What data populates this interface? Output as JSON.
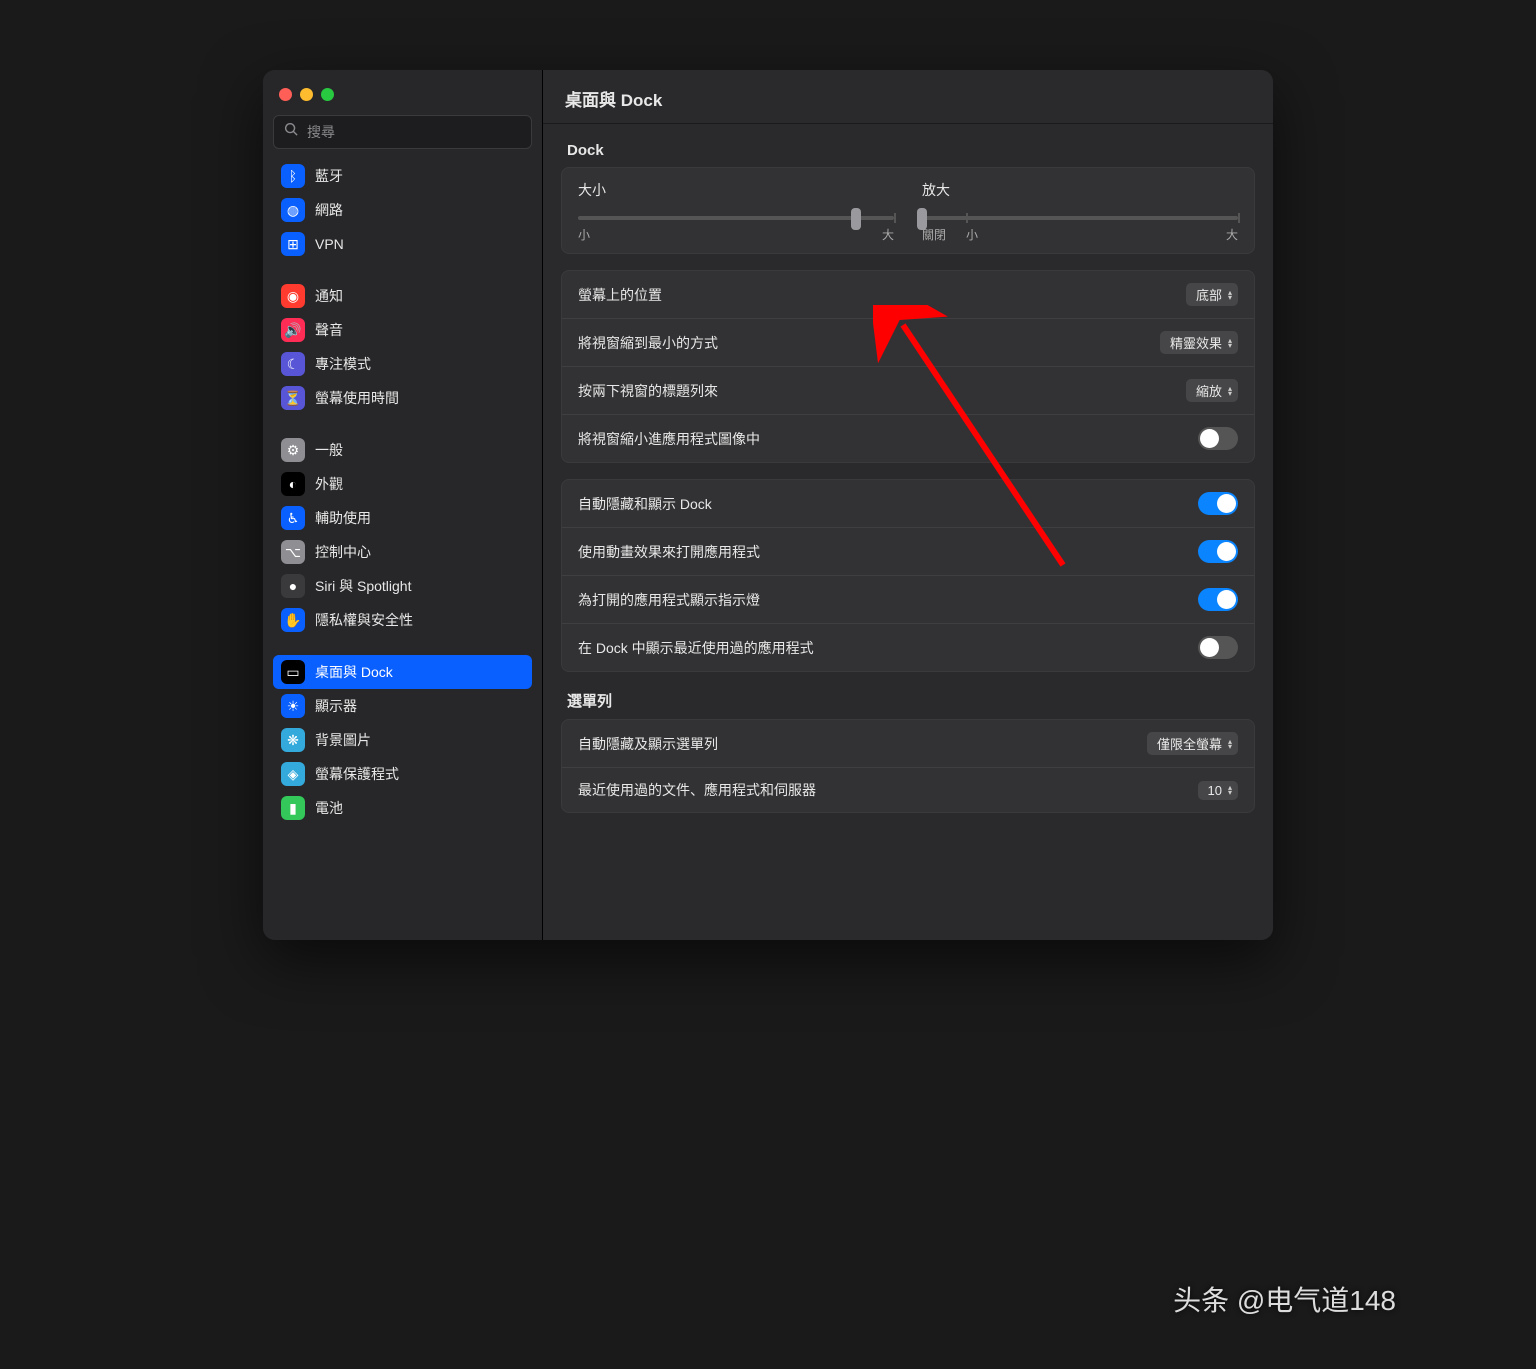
{
  "search": {
    "placeholder": "搜尋"
  },
  "sidebar": {
    "groups": [
      [
        {
          "label": "藍牙",
          "icon": "ᛒ",
          "bg": "#0a60ff"
        },
        {
          "label": "網路",
          "icon": "◍",
          "bg": "#0a60ff"
        },
        {
          "label": "VPN",
          "icon": "⊞",
          "bg": "#0a60ff"
        }
      ],
      [
        {
          "label": "通知",
          "icon": "◉",
          "bg": "#ff3b30"
        },
        {
          "label": "聲音",
          "icon": "🔊",
          "bg": "#ff2d55"
        },
        {
          "label": "專注模式",
          "icon": "☾",
          "bg": "#5856d6"
        },
        {
          "label": "螢幕使用時間",
          "icon": "⏳",
          "bg": "#5856d6"
        }
      ],
      [
        {
          "label": "一般",
          "icon": "⚙",
          "bg": "#8e8e93"
        },
        {
          "label": "外觀",
          "icon": "◐",
          "bg": "#000000"
        },
        {
          "label": "輔助使用",
          "icon": "♿︎",
          "bg": "#0a60ff"
        },
        {
          "label": "控制中心",
          "icon": "⌥",
          "bg": "#8e8e93"
        },
        {
          "label": "Siri 與 Spotlight",
          "icon": "●",
          "bg": "#3a3a3c"
        },
        {
          "label": "隱私權與安全性",
          "icon": "✋",
          "bg": "#0a60ff"
        }
      ],
      [
        {
          "label": "桌面與 Dock",
          "icon": "▭",
          "bg": "#000000",
          "selected": true
        },
        {
          "label": "顯示器",
          "icon": "☀",
          "bg": "#0a60ff"
        },
        {
          "label": "背景圖片",
          "icon": "❋",
          "bg": "#34aadc"
        },
        {
          "label": "螢幕保護程式",
          "icon": "◈",
          "bg": "#34aadc"
        },
        {
          "label": "電池",
          "icon": "▮",
          "bg": "#34c759"
        }
      ]
    ]
  },
  "page": {
    "title": "桌面與 Dock",
    "dock_section": "Dock",
    "menubar_section": "選單列",
    "size": {
      "label": "大小",
      "min": "小",
      "max": "大",
      "value_pct": 88
    },
    "mag": {
      "label": "放大",
      "off": "關閉",
      "min": "小",
      "max": "大",
      "value_pct": 0
    },
    "position": {
      "label": "螢幕上的位置",
      "value": "底部"
    },
    "minimize": {
      "label": "將視窗縮到最小的方式",
      "value": "精靈效果"
    },
    "dblclick": {
      "label": "按兩下視窗的標題列來",
      "value": "縮放"
    },
    "into_icon": {
      "label": "將視窗縮小進應用程式圖像中",
      "on": false
    },
    "autohide": {
      "label": "自動隱藏和顯示 Dock",
      "on": true
    },
    "animate": {
      "label": "使用動畫效果來打開應用程式",
      "on": true
    },
    "indicators": {
      "label": "為打開的應用程式顯示指示燈",
      "on": true
    },
    "recent": {
      "label": "在 Dock 中顯示最近使用過的應用程式",
      "on": false
    },
    "menubar_hide": {
      "label": "自動隱藏及顯示選單列",
      "value": "僅限全螢幕"
    },
    "recent_docs": {
      "label": "最近使用過的文件、應用程式和伺服器",
      "value": "10"
    }
  },
  "watermark": "头条 @电气道148"
}
